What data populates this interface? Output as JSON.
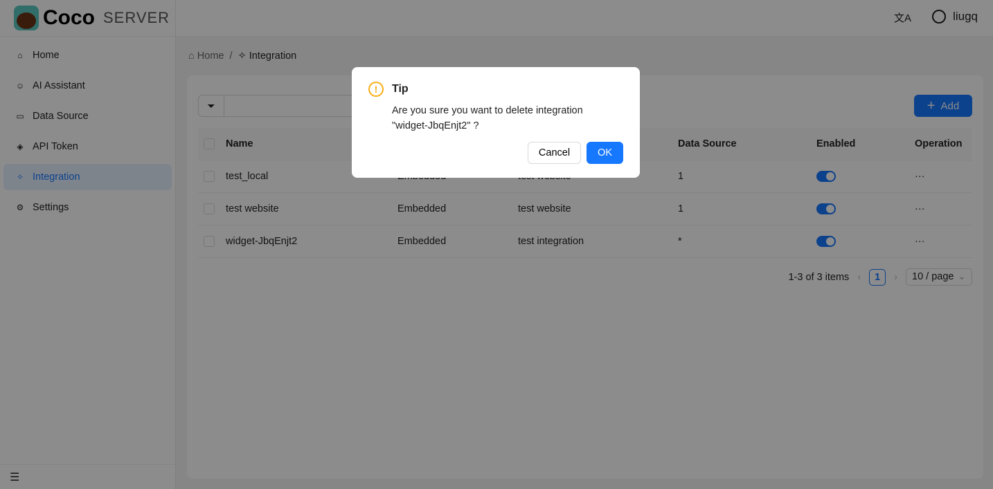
{
  "app": {
    "name": "Coco",
    "subtitle": "SERVER"
  },
  "header": {
    "user": "liugq",
    "translate_icon": "translate-icon"
  },
  "sidebar": {
    "items": [
      {
        "label": "Home",
        "icon": "⌂"
      },
      {
        "label": "AI Assistant",
        "icon": "☺"
      },
      {
        "label": "Data Source",
        "icon": "▭"
      },
      {
        "label": "API Token",
        "icon": "◈"
      },
      {
        "label": "Integration",
        "icon": "✧"
      },
      {
        "label": "Settings",
        "icon": "⚙"
      }
    ],
    "active": "Integration"
  },
  "breadcrumb": {
    "home": "Home",
    "sep": "/",
    "current": "Integration"
  },
  "toolbar": {
    "add_label": "Add",
    "search_value": ""
  },
  "table": {
    "headers": {
      "name": "Name",
      "col2": "",
      "col3": "",
      "data_source": "Data Source",
      "enabled": "Enabled",
      "operation": "Operation"
    },
    "rows": [
      {
        "name": "test_local",
        "type": "Embedded",
        "desc": "test website",
        "data_source": "1",
        "enabled": true,
        "op": "···"
      },
      {
        "name": "test website",
        "type": "Embedded",
        "desc": "test website",
        "data_source": "1",
        "enabled": true,
        "op": "···"
      },
      {
        "name": "widget-JbqEnjt2",
        "type": "Embedded",
        "desc": "test integration",
        "data_source": "*",
        "enabled": true,
        "op": "···"
      }
    ]
  },
  "pagination": {
    "summary": "1-3 of 3 items",
    "current": "1",
    "page_size": "10 / page"
  },
  "modal": {
    "title": "Tip",
    "message": "Are you sure you want to delete integration \"widget-JbqEnjt2\" ?",
    "cancel": "Cancel",
    "ok": "OK"
  },
  "colors": {
    "primary": "#1677ff",
    "warning": "#faad14"
  }
}
